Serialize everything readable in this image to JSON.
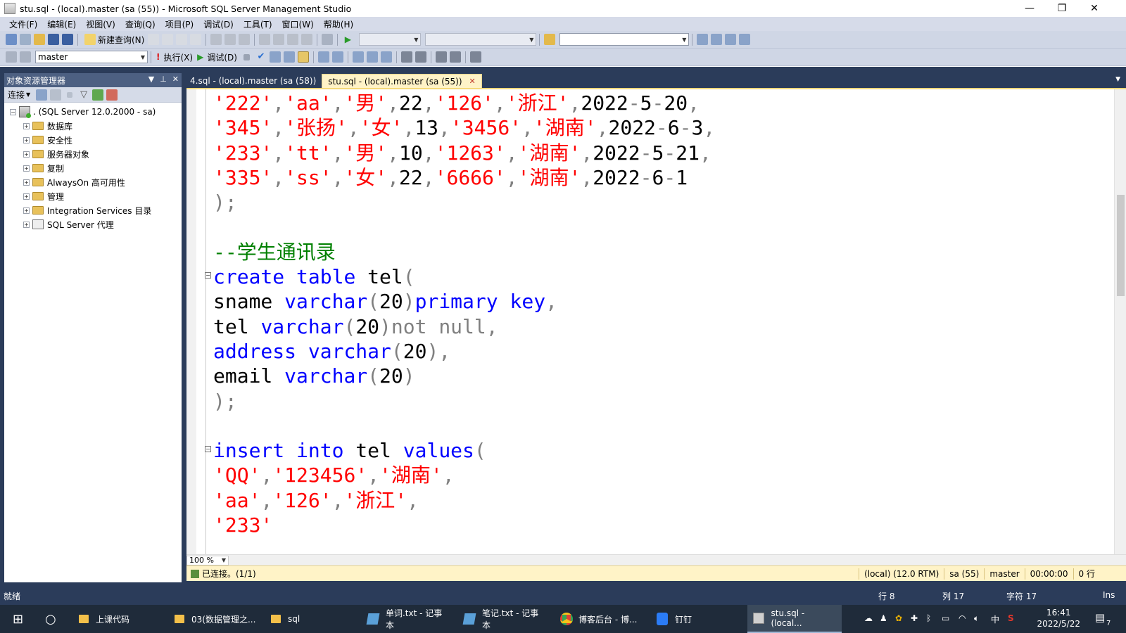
{
  "window": {
    "title": "stu.sql - (local).master (sa (55)) - Microsoft SQL Server Management Studio",
    "minimize": "—",
    "restore": "❐",
    "close": "✕"
  },
  "menu": [
    "文件(F)",
    "编辑(E)",
    "视图(V)",
    "查询(Q)",
    "项目(P)",
    "调试(D)",
    "工具(T)",
    "窗口(W)",
    "帮助(H)"
  ],
  "toolbar1": {
    "new_query_label": "新建查询(N)"
  },
  "toolbar2": {
    "database": "master",
    "execute_label": "执行(X)",
    "debug_label": "调试(D)"
  },
  "object_explorer": {
    "title": "对象资源管理器",
    "connect_label": "连接",
    "server": ". (SQL Server 12.0.2000 - sa)",
    "nodes": [
      "数据库",
      "安全性",
      "服务器对象",
      "复制",
      "AlwaysOn 高可用性",
      "管理",
      "Integration Services 目录",
      "SQL Server 代理"
    ]
  },
  "tabs": {
    "inactive": "4.sql - (local).master (sa (58))",
    "active": "stu.sql - (local).master (sa (55))"
  },
  "code_lines": [
    "'222','aa','男',22,'126','浙江',2022-5-20,",
    "'345','张扬','女',13,'3456','湖南',2022-6-3,",
    "'233','tt','男',10,'1263','湖南',2022-5-21,",
    "'335','ss','女',22,'6666','湖南',2022-6-1",
    ");",
    "",
    "--学生通讯录",
    "create table tel(",
    "sname varchar(20)primary key,",
    "tel varchar(20)not null,",
    "address varchar(20),",
    "email varchar(20)",
    ");",
    "",
    "insert into tel values(",
    "'QQ','123456','湖南',",
    "'aa','126','浙江',",
    "'233'"
  ],
  "editor_footer": {
    "zoom": "100 %"
  },
  "connection_bar": {
    "status": "已连接。(1/1)",
    "server": "(local) (12.0 RTM)",
    "user": "sa (55)",
    "database": "master",
    "elapsed": "00:00:00",
    "rows": "0 行"
  },
  "statusbar": {
    "ready": "就绪",
    "line": "行 8",
    "col": "列 17",
    "char": "字符 17",
    "mode": "Ins"
  },
  "taskbar": {
    "items": [
      "上课代码",
      "03(数据管理之...",
      "sql",
      "单词.txt - 记事本",
      "笔记.txt - 记事本",
      "博客后台 - 博...",
      "钉钉",
      "stu.sql - (local..."
    ],
    "ime": "中",
    "time": "16:41",
    "date": "2022/5/22",
    "notifications": "7"
  },
  "colors": {
    "keyword": "#0000ff",
    "string": "#ff0000",
    "comment": "#008000",
    "gray_keyword": "#808080",
    "chrome_band": "#2b3c5a"
  }
}
